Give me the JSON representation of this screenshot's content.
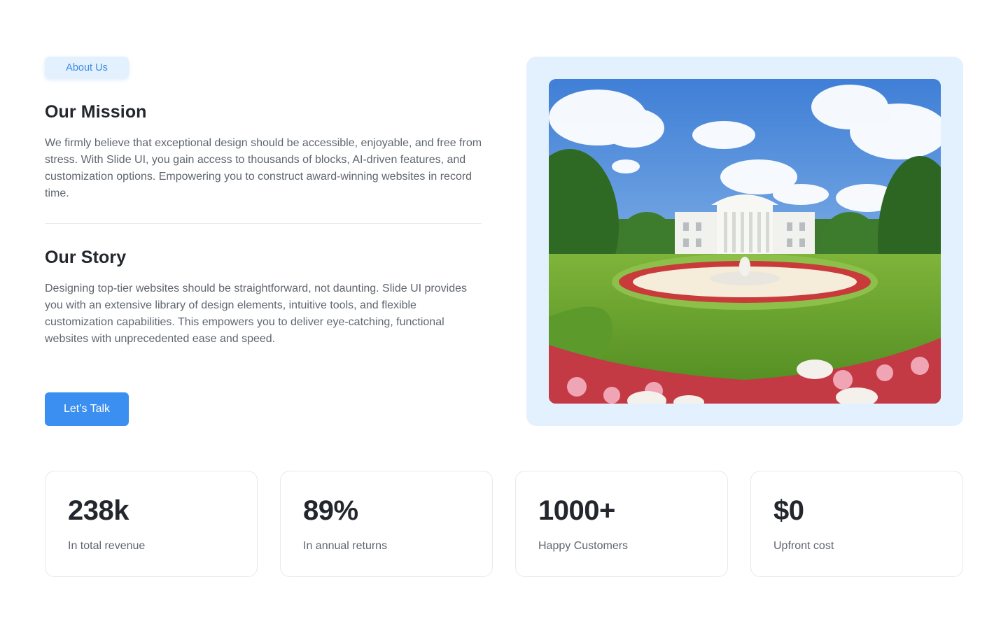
{
  "badge": {
    "label": "About Us"
  },
  "mission": {
    "title": "Our Mission",
    "body": "We firmly believe that exceptional design should be accessible, enjoyable, and free from stress. With Slide UI, you gain access to thousands of blocks, AI-driven features, and customization options. Empowering you to construct award-winning websites in record time."
  },
  "story": {
    "title": "Our Story",
    "body": "Designing top-tier websites should be straightforward, not daunting. Slide UI provides you with an extensive library of design elements, intuitive tools, and flexible customization capabilities. This empowers you to deliver eye-catching, functional websites with unprecedented ease and speed."
  },
  "cta": {
    "label": "Let’s Talk"
  },
  "colors": {
    "accent": "#3b8ff0",
    "badge_bg": "#e3f0fd",
    "frame_bg": "#e3f0fd"
  },
  "stats": [
    {
      "value": "238k",
      "label": "In total revenue"
    },
    {
      "value": "89%",
      "label": "In annual returns"
    },
    {
      "value": "1000+",
      "label": "Happy Customers"
    },
    {
      "value": "$0",
      "label": "Upfront cost"
    }
  ]
}
